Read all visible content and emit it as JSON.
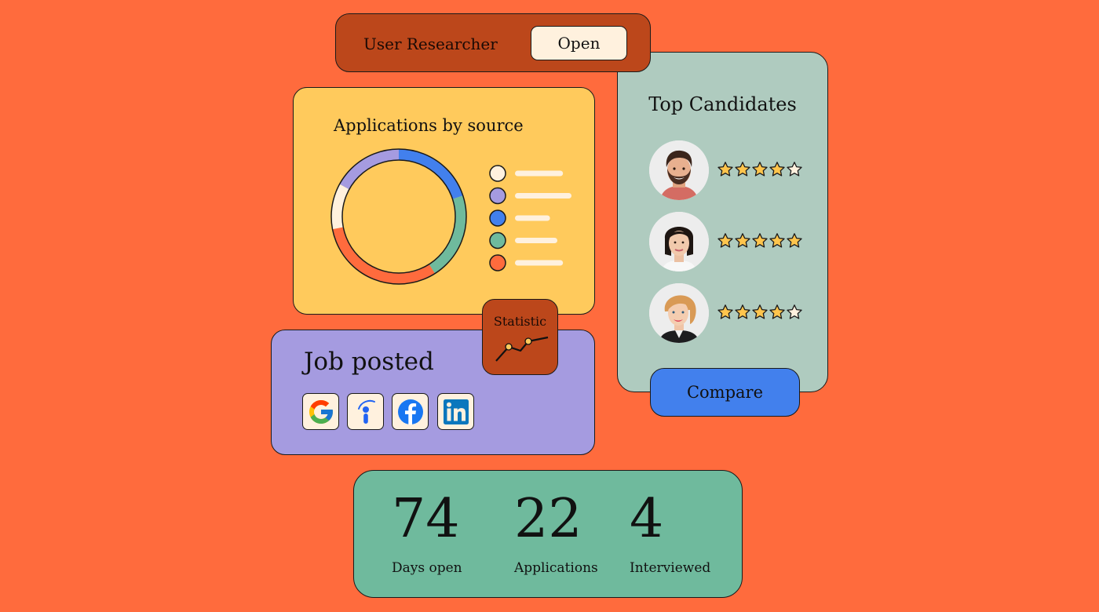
{
  "job_bar": {
    "title": "User Researcher",
    "status_button": "Open"
  },
  "applications_card": {
    "title": "Applications by source",
    "chart_data": {
      "type": "pie",
      "variant": "donut",
      "title": "Applications by source",
      "legend_placement": "right",
      "legend_labels_hidden": true,
      "slices": [
        {
          "color": "#4280ED",
          "share": 0.2
        },
        {
          "color": "#6FBA9D",
          "share": 0.21
        },
        {
          "color": "#FF6B3D",
          "share": 0.31
        },
        {
          "color": "#FFF1DE",
          "share": 0.11
        },
        {
          "color": "#A59BE0",
          "share": 0.17
        }
      ],
      "legend": [
        {
          "color": "#FFF1DE",
          "placeholder_length": 0.85
        },
        {
          "color": "#A59BE0",
          "placeholder_length": 1.0
        },
        {
          "color": "#4280ED",
          "placeholder_length": 0.62
        },
        {
          "color": "#6FBA9D",
          "placeholder_length": 0.75
        },
        {
          "color": "#FF6B3D",
          "placeholder_length": 0.85
        }
      ]
    }
  },
  "top_candidates": {
    "title": "Top Candidates",
    "max_rating": 5,
    "candidates": [
      {
        "avatar": "bearded-man-photo",
        "rating": 4
      },
      {
        "avatar": "dark-haired-woman-photo",
        "rating": 5
      },
      {
        "avatar": "blonde-woman-photo",
        "rating": 4
      }
    ],
    "compare_button": "Compare"
  },
  "job_posted": {
    "title": "Job posted",
    "sites": [
      {
        "name": "Google",
        "icon": "google-icon"
      },
      {
        "name": "Indeed",
        "icon": "indeed-icon"
      },
      {
        "name": "Facebook",
        "icon": "facebook-icon"
      },
      {
        "name": "LinkedIn",
        "icon": "linkedin-icon"
      }
    ]
  },
  "statistic_tile": {
    "label": "Statistic",
    "icon": "line-chart-icon"
  },
  "stats": [
    {
      "value": "74",
      "label": "Days open"
    },
    {
      "value": "22",
      "label": "Applications"
    },
    {
      "value": "4",
      "label": "Interviewed"
    }
  ],
  "colors": {
    "background": "#FF6B3D",
    "rust": "#BC471B",
    "cream": "#FFF1DE",
    "yellow": "#FFCA5C",
    "sage": "#AFCBBF",
    "lavender": "#A59BE0",
    "blue": "#4280ED",
    "green": "#6FBA9D",
    "star_filled": "#FFC54D",
    "star_empty": "#FFF1DE"
  }
}
